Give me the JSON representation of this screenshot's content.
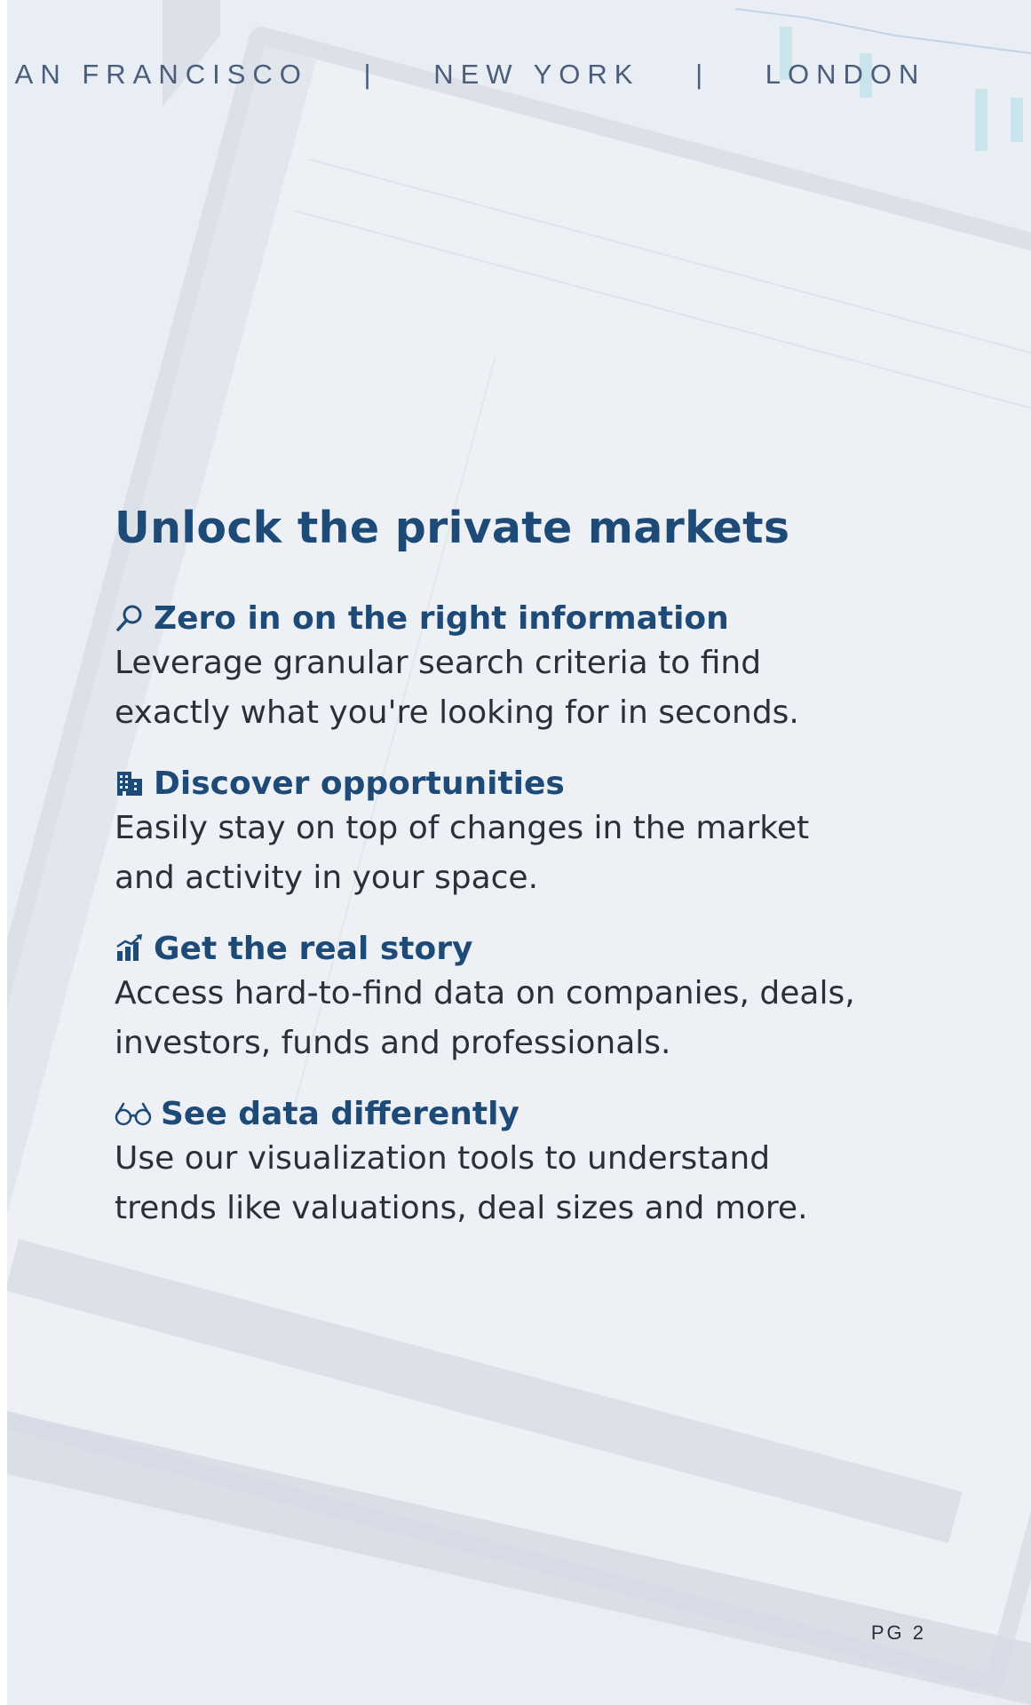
{
  "header": {
    "cities": [
      "SAN FRANCISCO",
      "NEW YORK",
      "LONDON"
    ],
    "separator": "|"
  },
  "headline": "Unlock the private markets",
  "features": [
    {
      "icon": "magnifier-icon",
      "title": "Zero in on the right information",
      "description": "Leverage granular search criteria to find exactly what you're looking for in seconds."
    },
    {
      "icon": "building-icon",
      "title": "Discover opportunities",
      "description": "Easily stay on top of changes in the market and activity in your space."
    },
    {
      "icon": "growth-chart-icon",
      "title": "Get the real story",
      "description": "Access hard-to-find data on companies, deals, investors, funds and professionals."
    },
    {
      "icon": "glasses-icon",
      "title": "See data differently",
      "description": "Use our visualization tools to understand trends like valuations, deal sizes and more."
    }
  ],
  "page_number": "PG 2",
  "colors": {
    "accent": "#1e4a78",
    "body_text": "#2b2f3a",
    "background": "#e9edf4"
  }
}
